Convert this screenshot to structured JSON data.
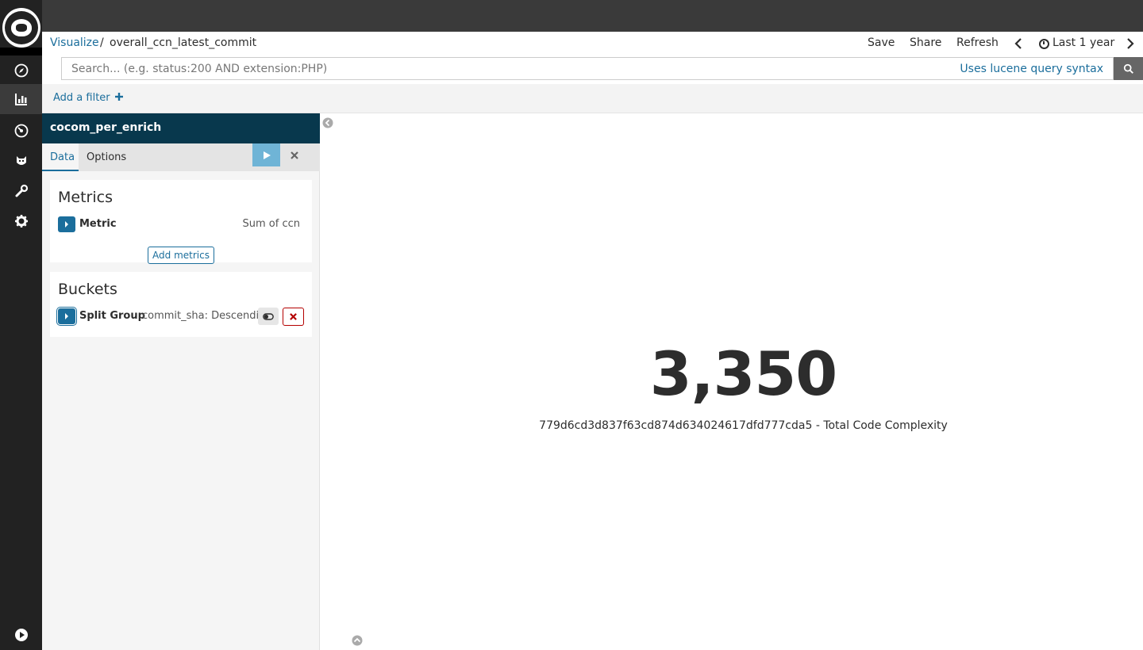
{
  "nav": {
    "items": [
      "discover",
      "visualize",
      "dashboard",
      "timelion",
      "dev-tools",
      "management"
    ],
    "active": "visualize"
  },
  "header": {
    "breadcrumb_root": "Visualize",
    "breadcrumb_sep": "/",
    "breadcrumb_current": "overall_ccn_latest_commit",
    "save_label": "Save",
    "share_label": "Share",
    "refresh_label": "Refresh",
    "time_range_label": "Last 1 year"
  },
  "search": {
    "placeholder": "Search... (e.g. status:200 AND extension:PHP)",
    "syntax_link": "Uses lucene query syntax"
  },
  "filters": {
    "add_filter_label": "Add a filter"
  },
  "sidebar": {
    "index_pattern": "cocom_per_enrich",
    "tabs": [
      {
        "label": "Data",
        "active": true
      },
      {
        "label": "Options",
        "active": false
      }
    ],
    "metrics": {
      "title": "Metrics",
      "items": [
        {
          "label": "Metric",
          "description": "Sum of ccn"
        }
      ],
      "add_label": "Add metrics"
    },
    "buckets": {
      "title": "Buckets",
      "items": [
        {
          "label": "Split Group",
          "description": "commit_sha: Descending"
        }
      ]
    }
  },
  "visualization": {
    "value": "3,350",
    "label": "779d6cd3d837f63cd874d634024617dfd777cda5 - Total Code Complexity"
  },
  "colors": {
    "link": "#1b6e9c",
    "nav_bg": "#222222",
    "index_header_bg": "#08384d",
    "apply_button": "#6fb4d6",
    "remove_border": "#b40000"
  }
}
